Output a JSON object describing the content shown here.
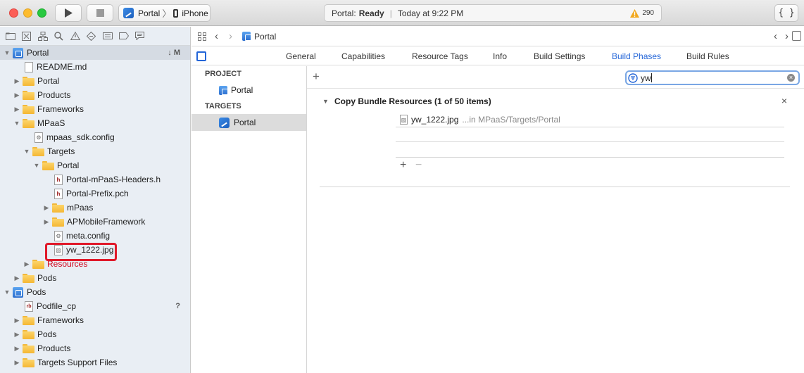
{
  "toolbar": {
    "scheme_target": "Portal",
    "scheme_device": "iPhone",
    "status_project": "Portal:",
    "status_state": "Ready",
    "status_separator": "|",
    "status_time": "Today at 9:22 PM",
    "warning_count": "290",
    "braces_label": "{ }"
  },
  "navigator": {
    "items": [
      {
        "label": "Portal",
        "badge": "↓ M"
      },
      {
        "label": "README.md"
      },
      {
        "label": "Portal"
      },
      {
        "label": "Products"
      },
      {
        "label": "Frameworks"
      },
      {
        "label": "MPaaS"
      },
      {
        "label": "mpaas_sdk.config"
      },
      {
        "label": "Targets"
      },
      {
        "label": "Portal"
      },
      {
        "label": "Portal-mPaaS-Headers.h"
      },
      {
        "label": "Portal-Prefix.pch"
      },
      {
        "label": "mPaas"
      },
      {
        "label": "APMobileFramework"
      },
      {
        "label": "meta.config"
      },
      {
        "label": "yw_1222.jpg"
      },
      {
        "label": "Resources"
      },
      {
        "label": "Pods"
      },
      {
        "label": "Pods"
      },
      {
        "label": "Podfile_cp",
        "badge": "?"
      },
      {
        "label": "Frameworks"
      },
      {
        "label": "Pods"
      },
      {
        "label": "Products"
      },
      {
        "label": "Targets Support Files"
      }
    ]
  },
  "editor": {
    "breadcrumb": "Portal",
    "tabs": [
      "General",
      "Capabilities",
      "Resource Tags",
      "Info",
      "Build Settings",
      "Build Phases",
      "Build Rules"
    ],
    "active_tab": "Build Phases",
    "project_header": "PROJECT",
    "project_item": "Portal",
    "targets_header": "TARGETS",
    "target_item": "Portal",
    "filter_value": "yw",
    "phase_title": "Copy Bundle Resources (1 of 50 items)",
    "phase_file_name": "yw_1222.jpg",
    "phase_file_path": "...in MPaaS/Targets/Portal"
  },
  "colors": {
    "accent": "#2466d8",
    "highlight_red": "#e0192a",
    "warning": "#f2a81d"
  }
}
